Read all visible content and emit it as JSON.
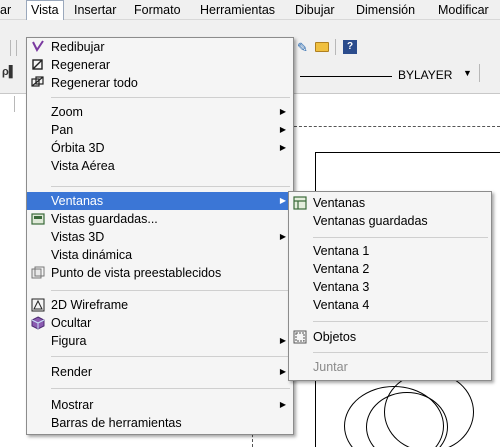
{
  "menubar": {
    "items": [
      "ar",
      "Vista",
      "Insertar",
      "Formato",
      "Herramientas",
      "Dibujar",
      "Dimensión",
      "Modificar"
    ],
    "open": "Vista"
  },
  "toolbar": {
    "linetype_label": "BYLAYER"
  },
  "vista_menu": {
    "items": [
      {
        "label": "Redibujar",
        "icon": "redraw-icon"
      },
      {
        "label": "Regenerar",
        "icon": "regen-icon"
      },
      {
        "label": "Regenerar todo",
        "icon": "regen-all-icon"
      },
      {
        "label": "Zoom",
        "submenu": true
      },
      {
        "label": "Pan",
        "submenu": true
      },
      {
        "label": "Órbita 3D",
        "submenu": true
      },
      {
        "label": "Vista Aérea"
      },
      {
        "label": "Ventanas",
        "submenu": true,
        "highlighted": true
      },
      {
        "label": "Vistas guardadas...",
        "icon": "saved-views-icon"
      },
      {
        "label": "Vistas 3D",
        "submenu": true
      },
      {
        "label": "Vista dinámica"
      },
      {
        "label": "Punto de vista preestablecidos",
        "icon": "viewpoint-icon"
      },
      {
        "label": "2D Wireframe",
        "icon": "wireframe-icon"
      },
      {
        "label": "Ocultar",
        "icon": "hide-icon"
      },
      {
        "label": "Figura",
        "submenu": true
      },
      {
        "label": "Render",
        "submenu": true
      },
      {
        "label": "Mostrar",
        "submenu": true
      },
      {
        "label": "Barras de herramientas"
      }
    ]
  },
  "ventanas_submenu": {
    "items": [
      {
        "label": "Ventanas",
        "icon": "viewports-icon"
      },
      {
        "label": "Ventanas guardadas"
      },
      {
        "label": "Ventana 1"
      },
      {
        "label": "Ventana 2"
      },
      {
        "label": "Ventana 3"
      },
      {
        "label": "Ventana 4"
      },
      {
        "label": "Objetos",
        "icon": "objects-icon"
      },
      {
        "label": "Juntar",
        "disabled": true
      }
    ]
  },
  "colors": {
    "highlight": "#3b76d6",
    "menu_bg": "#f5f5f5",
    "disabled": "#8a8a8a"
  }
}
